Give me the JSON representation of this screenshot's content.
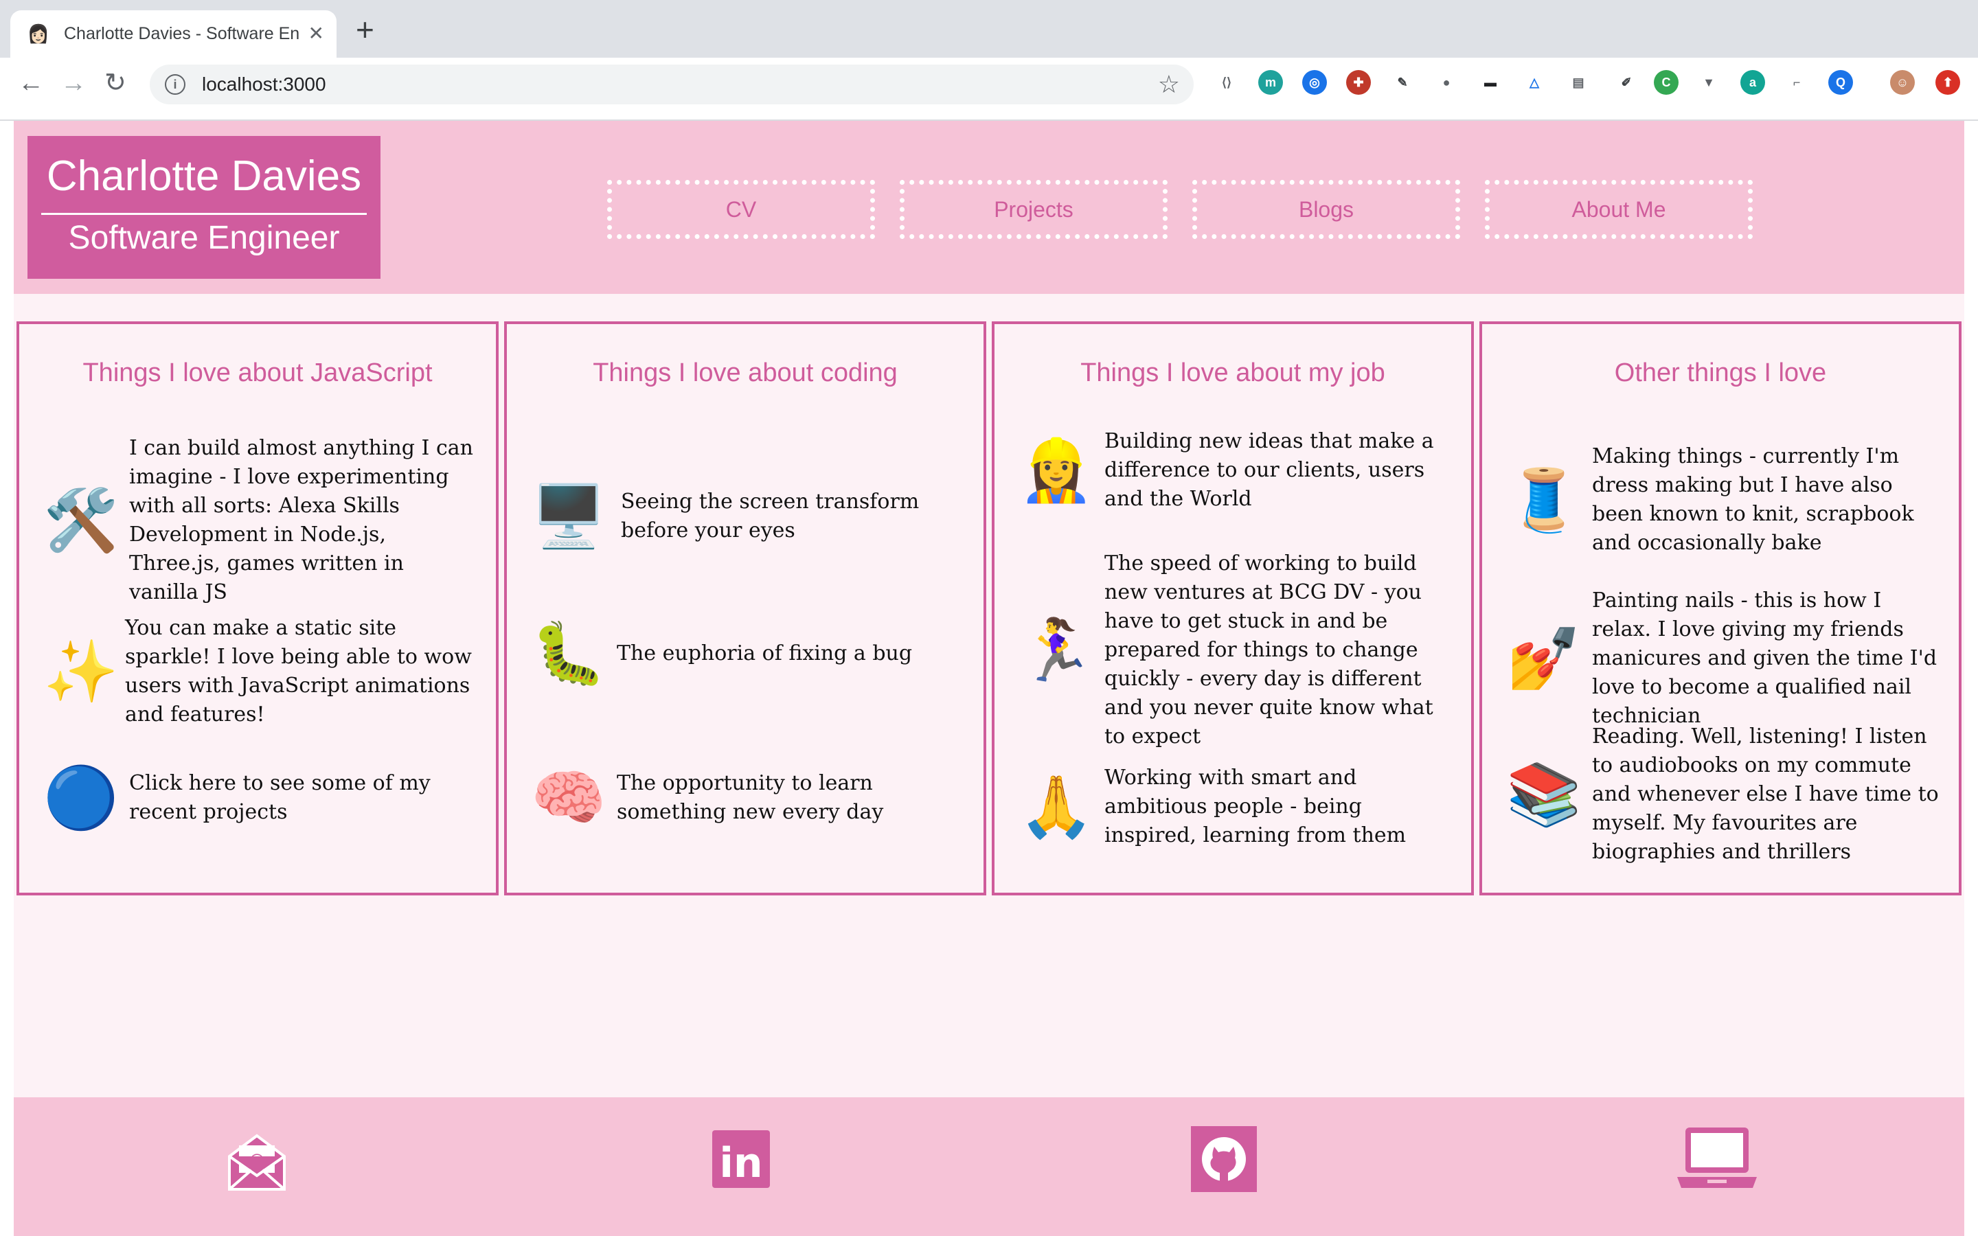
{
  "browser": {
    "tab_title": "Charlotte Davies - Software En",
    "tab_favicon": "👩🏻",
    "close_glyph": "✕",
    "new_tab_glyph": "+",
    "back_glyph": "←",
    "forward_glyph": "→",
    "reload_glyph": "↻",
    "url": "localhost:3000",
    "info_glyph": "i",
    "star_glyph": "☆",
    "extension_icons": [
      "code-extension-icon",
      "m-extension-icon",
      "compass-extension-icon",
      "puzzle-extension-icon",
      "pen-extension-icon",
      "circle-extension-icon",
      "mask-extension-icon",
      "triangle-extension-icon",
      "note-extension-icon",
      "eyedropper-extension-icon",
      "cors-extension-icon",
      "pocket-extension-icon",
      "a-extension-icon",
      "pin-extension-icon",
      "q-extension-icon",
      "profile-avatar",
      "update-icon"
    ]
  },
  "header": {
    "name": "Charlotte Davies",
    "role": "Software Engineer",
    "nav": [
      "CV",
      "Projects",
      "Blogs",
      "About Me"
    ]
  },
  "cards": [
    {
      "title": "Things I love about JavaScript",
      "items": [
        {
          "emoji": "🛠️",
          "icon": "hammer-wrench-icon",
          "text": "I can build almost anything I can imagine - I love experimenting with all sorts: Alexa Skills Development in Node.js, Three.js, games written in vanilla JS"
        },
        {
          "emoji": "✨",
          "icon": "sparkles-icon",
          "text": "You can make a static site sparkle! I love being able to wow users with JavaScript animations and features!"
        },
        {
          "emoji": "🔵",
          "icon": "button-icon",
          "text": "Click here to see some of my recent projects"
        }
      ]
    },
    {
      "title": "Things I love about coding",
      "items": [
        {
          "emoji": "🖥️",
          "icon": "desktop-computer-icon",
          "text": "Seeing the screen transform before your eyes"
        },
        {
          "emoji": "🐛",
          "icon": "bug-icon",
          "text": "The euphoria of fixing a bug"
        },
        {
          "emoji": "🧠",
          "icon": "brain-icon",
          "text": "The opportunity to learn something new every day"
        }
      ]
    },
    {
      "title": "Things I love about my job",
      "items": [
        {
          "emoji": "👷‍♀️",
          "icon": "construction-worker-icon",
          "text": "Building new ideas that make a difference to our clients, users and the World"
        },
        {
          "emoji": "🏃‍♀️",
          "icon": "runner-icon",
          "text": "The speed of working to build new ventures at BCG DV - you have to get stuck in and be prepared for things to change quickly - every day is different and you never quite know what to expect"
        },
        {
          "emoji": "🙏",
          "icon": "praying-hands-icon",
          "text": "Working with smart and ambitious people - being inspired, learning from them"
        }
      ]
    },
    {
      "title": "Other things I love",
      "items": [
        {
          "emoji": "🧵",
          "icon": "thread-spool-icon",
          "text": "Making things - currently I'm dress making but I have also been known to knit, scrapbook and occasionally bake"
        },
        {
          "emoji": "💅",
          "icon": "nail-polish-icon",
          "text": "Painting nails - this is how I relax. I love giving my friends manicures and given the time I'd love to become a qualified nail technician"
        },
        {
          "emoji": "📚",
          "icon": "books-icon",
          "text": "Reading. Well, listening! I listen to audiobooks on my commute and whenever else I have time to myself. My favourites are biographies and thrillers"
        }
      ]
    }
  ],
  "footer": {
    "icons": [
      "email-icon",
      "linkedin-icon",
      "github-icon",
      "laptop-icon"
    ],
    "linkedin_glyph": "in"
  },
  "colors": {
    "accent": "#cf5c9b",
    "brand_bg": "#d05c9e",
    "header_bg": "#f6c3d7",
    "page_bg": "#fdf2f6"
  }
}
